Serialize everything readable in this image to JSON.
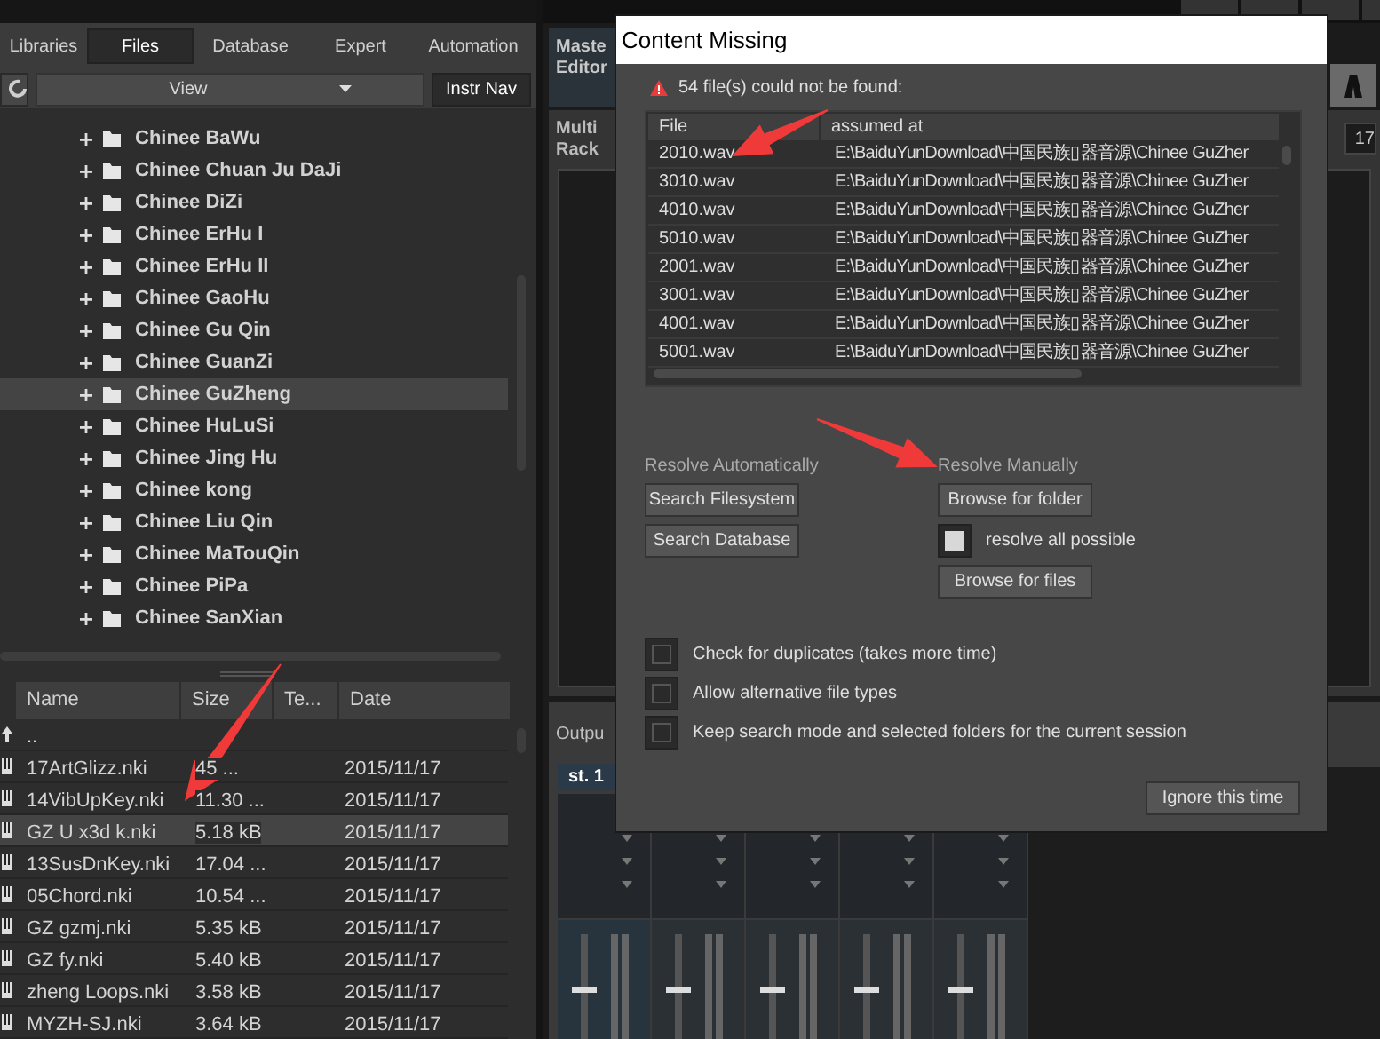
{
  "browser": {
    "tabs": [
      {
        "label": "Libraries",
        "selected": false
      },
      {
        "label": "Files",
        "selected": true
      },
      {
        "label": "Database",
        "selected": false
      },
      {
        "label": "Expert",
        "selected": false
      },
      {
        "label": "Automation",
        "selected": false
      }
    ],
    "view_dropdown": "View",
    "instr_nav_button": "Instr Nav",
    "folder_tree": [
      {
        "label": "Chinee BaWu",
        "expanded": false,
        "selected": false
      },
      {
        "label": "Chinee Chuan Ju DaJi",
        "expanded": false,
        "selected": false
      },
      {
        "label": "Chinee DiZi",
        "expanded": false,
        "selected": false
      },
      {
        "label": "Chinee ErHu I",
        "expanded": false,
        "selected": false
      },
      {
        "label": "Chinee ErHu II",
        "expanded": false,
        "selected": false
      },
      {
        "label": "Chinee GaoHu",
        "expanded": false,
        "selected": false
      },
      {
        "label": "Chinee Gu Qin",
        "expanded": false,
        "selected": false
      },
      {
        "label": "Chinee GuanZi",
        "expanded": false,
        "selected": false
      },
      {
        "label": "Chinee GuZheng",
        "expanded": false,
        "selected": true
      },
      {
        "label": "Chinee HuLuSi",
        "expanded": false,
        "selected": false
      },
      {
        "label": "Chinee Jing Hu",
        "expanded": false,
        "selected": false
      },
      {
        "label": "Chinee kong",
        "expanded": false,
        "selected": false
      },
      {
        "label": "Chinee Liu Qin",
        "expanded": false,
        "selected": false
      },
      {
        "label": "Chinee MaTouQin",
        "expanded": false,
        "selected": false
      },
      {
        "label": "Chinee PiPa",
        "expanded": false,
        "selected": false
      },
      {
        "label": "Chinee SanXian",
        "expanded": false,
        "selected": false
      }
    ],
    "file_table": {
      "columns": [
        "Name",
        "Size",
        "Te...",
        "Date"
      ],
      "rows": [
        {
          "kind": "parent",
          "name": "..",
          "selected": false
        },
        {
          "kind": "file",
          "name": "17ArtGlizz.nki",
          "size": "45 ...",
          "date": "2015/11/17",
          "selected": false
        },
        {
          "kind": "file",
          "name": "14VibUpKey.nki",
          "size": "11.30 ...",
          "date": "2015/11/17",
          "selected": false
        },
        {
          "kind": "file",
          "name": "GZ U x3d k.nki",
          "size": "5.18 kB",
          "date": "2015/11/17",
          "selected": true
        },
        {
          "kind": "file",
          "name": "13SusDnKey.nki",
          "size": "17.04 ...",
          "date": "2015/11/17",
          "selected": false
        },
        {
          "kind": "file",
          "name": "05Chord.nki",
          "size": "10.54 ...",
          "date": "2015/11/17",
          "selected": false
        },
        {
          "kind": "file",
          "name": "GZ gzmj.nki",
          "size": "5.35 kB",
          "date": "2015/11/17",
          "selected": false
        },
        {
          "kind": "file",
          "name": "GZ fy.nki",
          "size": "5.40 kB",
          "date": "2015/11/17",
          "selected": false
        },
        {
          "kind": "file",
          "name": "zheng Loops.nki",
          "size": "3.58 kB",
          "date": "2015/11/17",
          "selected": false
        },
        {
          "kind": "file",
          "name": "MYZH-SJ.nki",
          "size": "3.64 kB",
          "date": "2015/11/17",
          "selected": false
        }
      ]
    }
  },
  "master_editor": "Maste Editor",
  "multi_rack": {
    "title": "Multi Rack",
    "counter": "17"
  },
  "output": {
    "title": "Outpu",
    "tabs": [
      {
        "label": "st. 1",
        "selected": true
      }
    ],
    "channels": [
      {
        "level": 0.5
      },
      {
        "level": 0.5
      },
      {
        "level": 0.5
      },
      {
        "level": 0.5
      },
      {
        "level": 0.5
      }
    ]
  },
  "dialog": {
    "title": "Content Missing",
    "warning": "54 file(s) could not be found:",
    "columns": [
      "File",
      "assumed at"
    ],
    "rows": [
      {
        "file": "2010.wav",
        "path": "E:\\BaiduYunDownload\\中国民族▯器音源\\Chinee GuZher"
      },
      {
        "file": "3010.wav",
        "path": "E:\\BaiduYunDownload\\中国民族▯器音源\\Chinee GuZher"
      },
      {
        "file": "4010.wav",
        "path": "E:\\BaiduYunDownload\\中国民族▯器音源\\Chinee GuZher"
      },
      {
        "file": "5010.wav",
        "path": "E:\\BaiduYunDownload\\中国民族▯器音源\\Chinee GuZher"
      },
      {
        "file": "2001.wav",
        "path": "E:\\BaiduYunDownload\\中国民族▯器音源\\Chinee GuZher"
      },
      {
        "file": "3001.wav",
        "path": "E:\\BaiduYunDownload\\中国民族▯器音源\\Chinee GuZher"
      },
      {
        "file": "4001.wav",
        "path": "E:\\BaiduYunDownload\\中国民族▯器音源\\Chinee GuZher"
      },
      {
        "file": "5001.wav",
        "path": "E:\\BaiduYunDownload\\中国民族▯器音源\\Chinee GuZher"
      }
    ],
    "resolve_automatically": {
      "label": "Resolve Automatically",
      "buttons": [
        "Search Filesystem",
        "Search Database"
      ]
    },
    "resolve_manually": {
      "label": "Resolve Manually",
      "browse_folder": "Browse for folder",
      "resolve_all": {
        "label": "resolve all possible",
        "checked": true
      },
      "browse_files": "Browse for files"
    },
    "options": [
      {
        "label": "Check for duplicates (takes more time)",
        "checked": false
      },
      {
        "label": "Allow alternative file types",
        "checked": false
      },
      {
        "label": "Keep search mode and selected folders for the current session",
        "checked": false
      }
    ],
    "ignore_button": "Ignore this time"
  }
}
